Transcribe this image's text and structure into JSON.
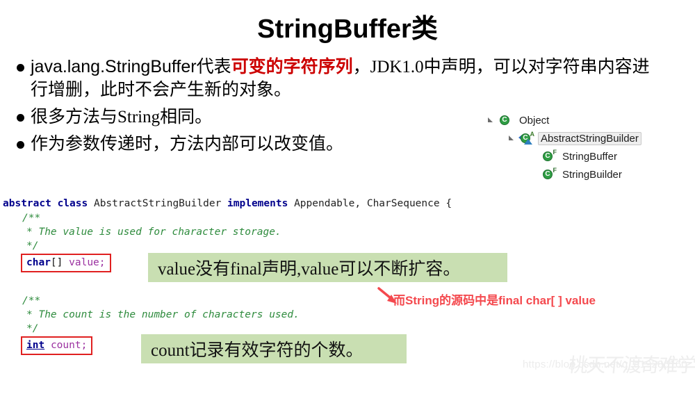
{
  "slide": {
    "title": "StringBuffer类"
  },
  "bullets": [
    {
      "seg_pre": "java.lang.StringBuffer代表",
      "seg_red": "可变的字符序列",
      "seg_post": "，JDK1.0中声明，可以对字符串内容进行增删，此时不会产生新的对象。"
    },
    {
      "text": "很多方法与String相同。"
    },
    {
      "text": "作为参数传递时，方法内部可以改变值。"
    }
  ],
  "hierarchy": {
    "nodes": [
      {
        "label": "Object",
        "icon": "class-icon",
        "badge": "",
        "expanded": true,
        "selected": false,
        "level": 1
      },
      {
        "label": "AbstractStringBuilder",
        "icon": "abstract-class-icon",
        "badge": "A",
        "expanded": true,
        "selected": true,
        "level": 2
      },
      {
        "label": "StringBuffer",
        "icon": "class-icon",
        "badge": "F",
        "expanded": false,
        "selected": false,
        "level": 3
      },
      {
        "label": "StringBuilder",
        "icon": "class-icon",
        "badge": "F",
        "expanded": false,
        "selected": false,
        "level": 3
      }
    ]
  },
  "code": {
    "line1_kw1": "abstract",
    "line1_kw2": "class",
    "line1_type": "AbstractStringBuilder",
    "line1_kw3": "implements",
    "line1_tail": "Appendable, CharSequence {",
    "comment1_open": "/**",
    "comment1_body": "* The value is used for character storage.",
    "comment1_close": "*/",
    "decl_value_kw": "char",
    "decl_value_brackets": "[]",
    "decl_value_name": "value",
    "decl_value_semi": ";",
    "comment2_open": "/**",
    "comment2_body": "* The count is the number of characters used.",
    "comment2_close": "*/",
    "decl_count_kw": "int",
    "decl_count_name": "count",
    "decl_count_semi": ";"
  },
  "callouts": {
    "value_note": "value没有final声明,value可以不断扩容。",
    "count_note": "count记录有效字符的个数。"
  },
  "annotation": {
    "red_note": "而String的源码中是final char[ ] value"
  },
  "watermark": {
    "url": "https://blog.csdn.net/q_a19286160",
    "seal": "桃天不渡奇难学的"
  },
  "colors": {
    "red_accent": "#cc0000",
    "annotation_red": "#f4494e",
    "callout_green": "#c9dfb2",
    "keyword_blue": "#00008c",
    "comment_green": "#2e8b3d",
    "field_purple": "#9b30a0",
    "box_red": "#e02020",
    "icon_green": "#2f9e44"
  }
}
